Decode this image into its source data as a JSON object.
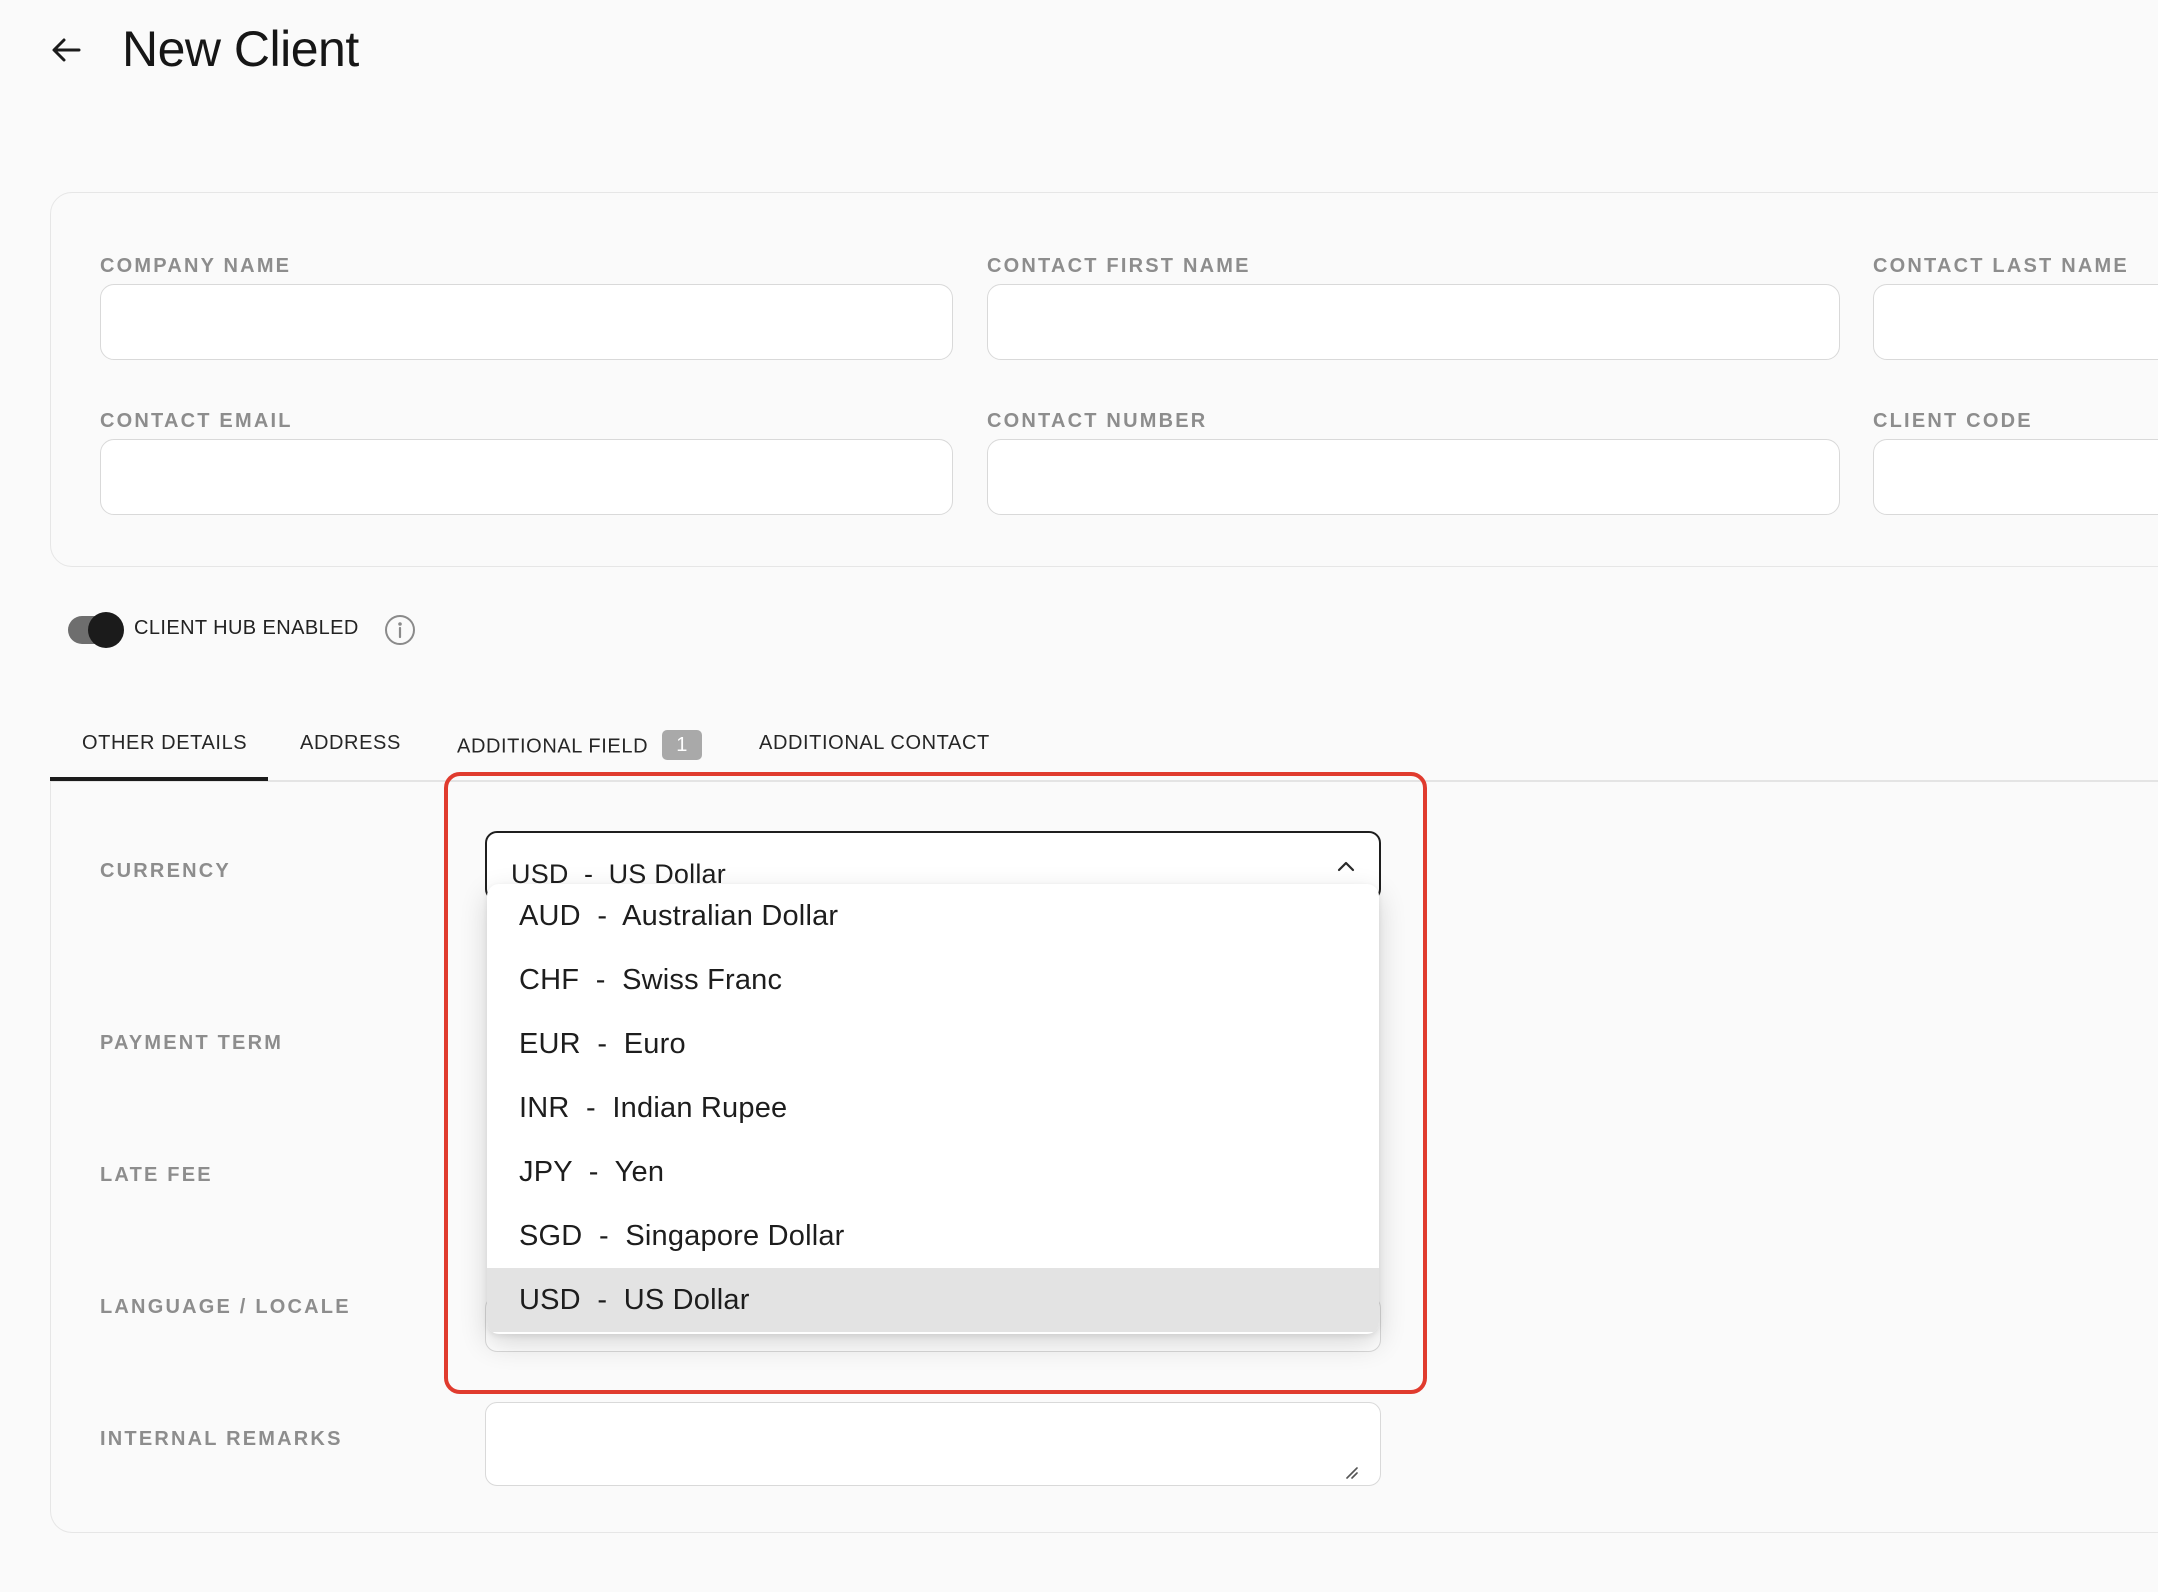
{
  "header": {
    "title": "New Client",
    "back_icon": "arrow-left-icon"
  },
  "client_fields": [
    {
      "label": "COMPANY NAME",
      "value": ""
    },
    {
      "label": "CONTACT FIRST NAME",
      "value": ""
    },
    {
      "label": "CONTACT LAST NAME",
      "value": ""
    },
    {
      "label": "CONTACT EMAIL",
      "value": ""
    },
    {
      "label": "CONTACT NUMBER",
      "value": ""
    },
    {
      "label": "CLIENT CODE",
      "value": ""
    }
  ],
  "client_hub": {
    "label": "CLIENT HUB ENABLED",
    "enabled": true,
    "info_icon": "info-icon"
  },
  "tabs": [
    {
      "label": "OTHER DETAILS",
      "active": true
    },
    {
      "label": "ADDRESS",
      "active": false
    },
    {
      "label": "ADDITIONAL FIELD",
      "badge": "1",
      "active": false
    },
    {
      "label": "ADDITIONAL CONTACT",
      "active": false
    }
  ],
  "other_details": {
    "currency_label": "CURRENCY",
    "payment_term_label": "PAYMENT TERM",
    "late_fee_label": "LATE FEE",
    "language_label": "LANGUAGE / LOCALE",
    "remarks_label": "INTERNAL REMARKS",
    "remarks_value": ""
  },
  "currency_select": {
    "value": "USD  -  US Dollar",
    "open": true,
    "options": [
      "AUD  -  Australian Dollar",
      "CHF  -  Swiss Franc",
      "EUR  -  Euro",
      "INR  -  Indian Rupee",
      "JPY  -  Yen",
      "SGD  -  Singapore Dollar",
      "USD  -  US Dollar"
    ],
    "selected_index": 6
  },
  "colors": {
    "highlight": "#e03b2e",
    "selected_option_bg": "#e3e3e3",
    "badge_bg": "#a9a9a9"
  }
}
